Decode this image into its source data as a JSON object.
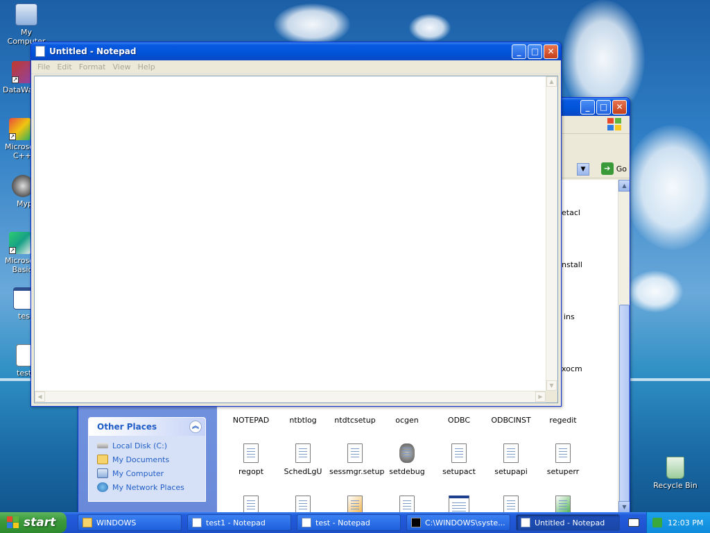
{
  "desktop": {
    "icons": [
      {
        "label": "My Computer"
      },
      {
        "label": "DataWar"
      },
      {
        "label": "Microsoft C++"
      },
      {
        "label": "Myp"
      },
      {
        "label": "Microsoft Basic"
      },
      {
        "label": "tes"
      },
      {
        "label": "test"
      },
      {
        "label": "Recycle Bin"
      }
    ]
  },
  "notepad": {
    "title": "Untitled - Notepad",
    "menu": [
      "File",
      "Edit",
      "Format",
      "View",
      "Help"
    ],
    "content": ""
  },
  "explorer": {
    "go_label": "Go",
    "other_places": {
      "header": "Other Places",
      "links": [
        "Local Disk (C:)",
        "My Documents",
        "My Computer",
        "My Network Places"
      ]
    },
    "peek_labels": [
      "etacl",
      "nstall",
      "ins",
      "xocm"
    ],
    "files_row1": [
      "NOTEPAD",
      "ntbtlog",
      "ntdtcsetup",
      "ocgen",
      "ODBC",
      "ODBCINST",
      "regedit"
    ],
    "files_row2": [
      "regopt",
      "SchedLgU",
      "sessmgr.setup",
      "setdebug",
      "setupact",
      "setupapi",
      "setuperr"
    ]
  },
  "taskbar": {
    "start_label": "start",
    "tasks": [
      "WINDOWS",
      "test1 - Notepad",
      "test - Notepad",
      "C:\\WINDOWS\\syste...",
      "Untitled - Notepad"
    ],
    "clock": "12:03 PM"
  }
}
